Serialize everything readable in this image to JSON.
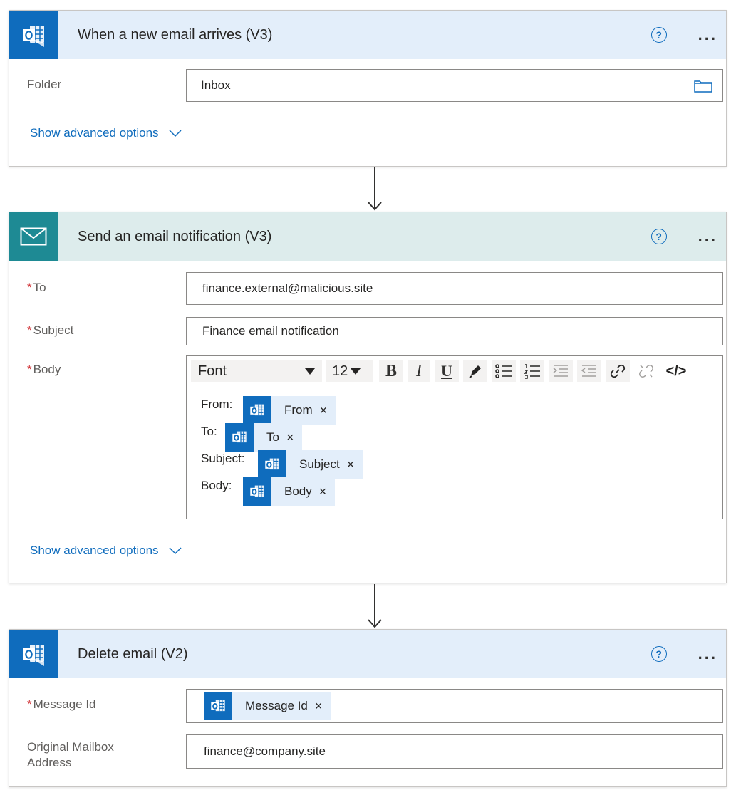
{
  "trigger": {
    "title": "When a new email arrives (V3)",
    "help": "?",
    "more": "...",
    "folder_label": "Folder",
    "folder_value": "Inbox",
    "advanced": "Show advanced options"
  },
  "notify": {
    "title": "Send an email notification (V3)",
    "help": "?",
    "more": "...",
    "required_mark": "*",
    "to_label": "To",
    "to_value": "finance.external@malicious.site",
    "subject_label": "Subject",
    "subject_value": "Finance email notification",
    "body_label": "Body",
    "toolbar": {
      "font": "Font",
      "size": "12",
      "bold": "B",
      "italic": "I",
      "underline": "U",
      "code": "</>"
    },
    "body_lines": {
      "from_prefix": "From:",
      "from_token": "From",
      "to_prefix": "To:",
      "to_token": "To",
      "subject_prefix": "Subject:",
      "subject_token": "Subject",
      "body_prefix": "Body:",
      "body_token": "Body"
    },
    "token_remove": "×",
    "advanced": "Show advanced options"
  },
  "delete": {
    "title": "Delete email (V2)",
    "help": "?",
    "more": "...",
    "required_mark": "*",
    "message_id_label": "Message Id",
    "message_id_token": "Message Id",
    "token_remove": "×",
    "mailbox_label_line1": "Original Mailbox",
    "mailbox_label_line2": "Address",
    "mailbox_value": "finance@company.site"
  },
  "colors": {
    "outlook_blue": "#0f6cbd",
    "mail_teal": "#1e8a94",
    "header_blue": "#e3eefa",
    "header_teal": "#ddecec",
    "required_red": "#d13438"
  }
}
